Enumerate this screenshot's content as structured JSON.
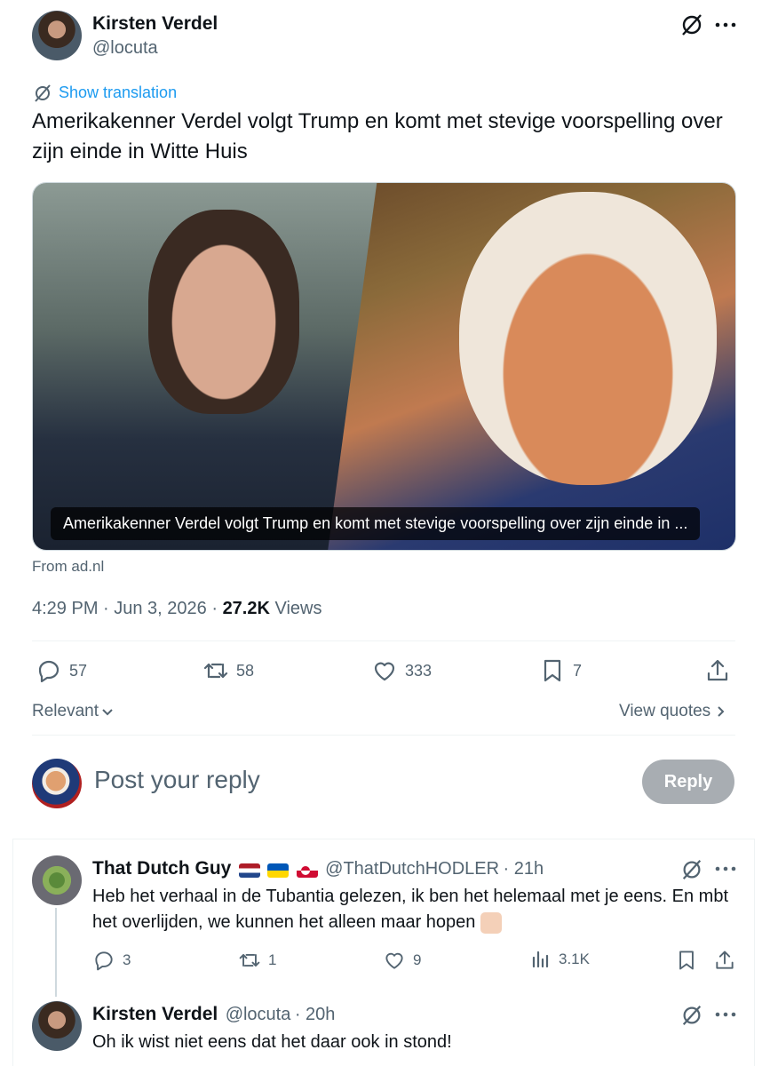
{
  "main_tweet": {
    "author_name": "Kirsten Verdel",
    "author_handle": "@locuta",
    "show_translation": "Show translation",
    "text": "Amerikakenner Verdel volgt Trump en komt met stevige voorspelling over zijn einde in Witte Huis",
    "card_caption": "Amerikakenner Verdel volgt Trump en komt met stevige voorspelling over zijn einde in ...",
    "card_source": "From ad.nl",
    "timestamp": "4:29 PM · Jun 3, 2026 · ",
    "views_count": "27.2K",
    "views_label": " Views",
    "replies": "57",
    "reposts": "58",
    "likes": "333",
    "bookmarks": "7"
  },
  "sort": {
    "relevant_label": "Relevant",
    "view_quotes_label": "View quotes"
  },
  "compose": {
    "placeholder": "Post your reply",
    "reply_button": "Reply"
  },
  "replies": [
    {
      "author_name": "That Dutch Guy",
      "author_handle": "@ThatDutchHODLER",
      "time": "21h",
      "text": "Heb het verhaal in de Tubantia gelezen, ik ben het helemaal met je eens. En mbt het overlijden, we kunnen het alleen maar hopen",
      "replies": "3",
      "reposts": "1",
      "likes": "9",
      "views": "3.1K"
    },
    {
      "author_name": "Kirsten Verdel",
      "author_handle": "@locuta",
      "time": "20h",
      "text": "Oh ik wist niet eens dat het daar ook in stond!"
    }
  ],
  "icons": {
    "grok": "grok-icon",
    "more": "more-icon",
    "reply": "reply-icon",
    "repost": "repost-icon",
    "like": "like-icon",
    "bookmark": "bookmark-icon",
    "share": "share-icon",
    "views": "views-icon"
  },
  "colors": {
    "link": "#1d9bf0",
    "muted": "#536471",
    "text": "#0f1419",
    "reply_button": "#8b9299"
  }
}
